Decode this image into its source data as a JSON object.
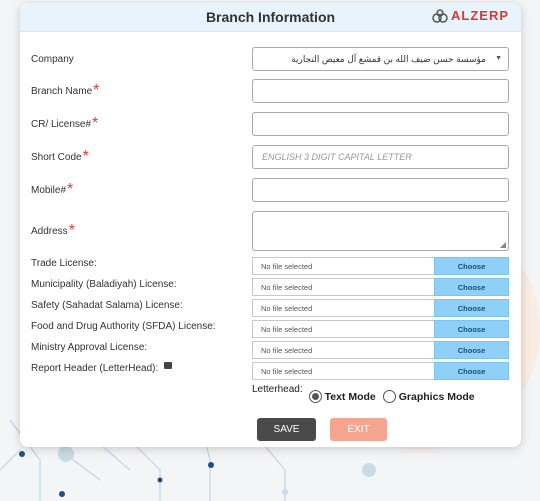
{
  "modal": {
    "title": "Branch Information",
    "logo_text": "ALZERP"
  },
  "form": {
    "company": {
      "label": "Company",
      "value": "مؤسسة حسن ضيف الله بن قمشع آل معيض التجارية"
    },
    "branch_name": {
      "label": "Branch Name",
      "required_mark": "*",
      "value": ""
    },
    "cr_license": {
      "label": "CR/ License#",
      "required_mark": "*",
      "value": ""
    },
    "short_code": {
      "label": "Short Code",
      "required_mark": "*",
      "placeholder": "ENGLISH 3 DIGIT CAPITAL LETTER"
    },
    "mobile": {
      "label": "Mobile#",
      "required_mark": "*",
      "value": ""
    },
    "address": {
      "label": "Address",
      "required_mark": "*",
      "value": ""
    }
  },
  "files": [
    {
      "label": "Trade License:",
      "file_text": "No file selected",
      "button": "Choose"
    },
    {
      "label": "Municipality (Baladiyah) License:",
      "file_text": "No file selected",
      "button": "Choose"
    },
    {
      "label": "Safety (Sahadat Salama) License:",
      "file_text": "No file selected",
      "button": "Choose"
    },
    {
      "label": "Food and Drug Authority (SFDA) License:",
      "file_text": "No file selected",
      "button": "Choose"
    },
    {
      "label": "Ministry Approval License:",
      "file_text": "No file selected",
      "button": "Choose"
    },
    {
      "label": "Report Header (LetterHead):",
      "file_text": "No file selected",
      "button": "Choose"
    }
  ],
  "letterhead": {
    "label": "Letterhead:",
    "options": [
      {
        "label": "Text Mode",
        "selected": true
      },
      {
        "label": "Graphics Mode",
        "selected": false
      }
    ]
  },
  "actions": {
    "save": "SAVE",
    "exit": "EXIT"
  },
  "colors": {
    "header_bg": "#e9f3fb",
    "choose_btn": "#8ed0f7",
    "save_btn": "#4a4a4a",
    "exit_btn": "#f5a58f",
    "required": "#e53935",
    "logo": "#d23a3a"
  }
}
